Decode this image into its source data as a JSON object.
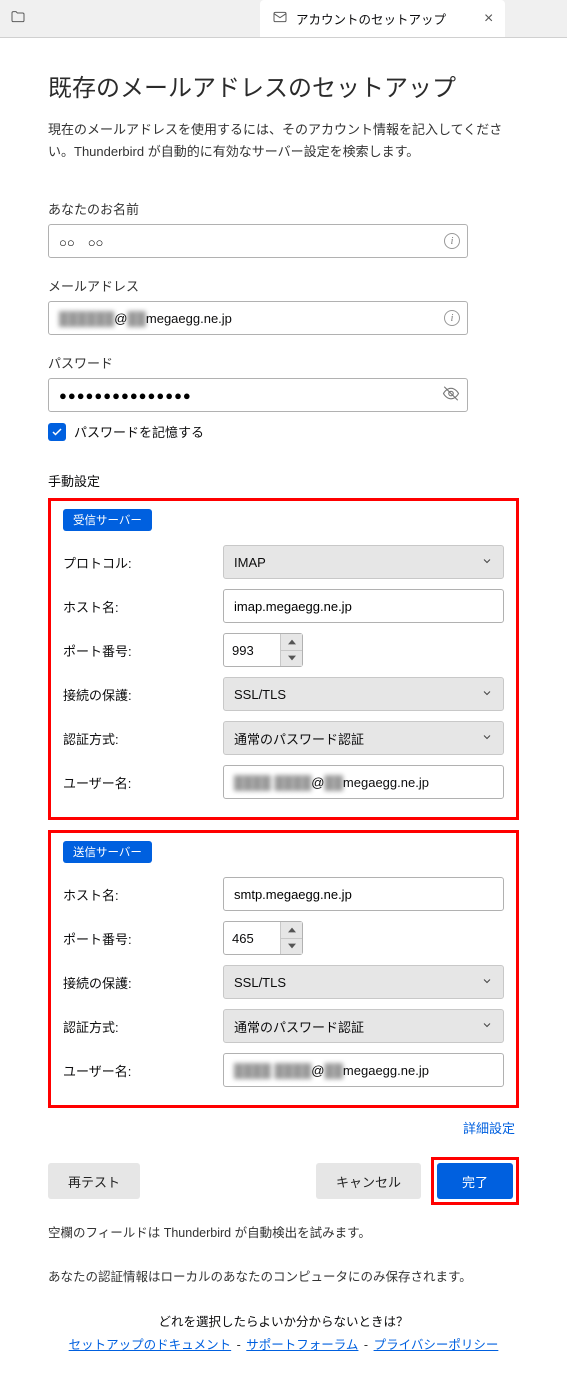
{
  "tab": {
    "title": "アカウントのセットアップ"
  },
  "heading": "既存のメールアドレスのセットアップ",
  "description": "現在のメールアドレスを使用するには、そのアカウント情報を記入してください。Thunderbird が自動的に有効なサーバー設定を検索します。",
  "fields": {
    "name_label": "あなたのお名前",
    "name_value": "○○　○○",
    "email_label": "メールアドレス",
    "email_hidden": "██████",
    "email_at": "@",
    "email_hidden2": "██",
    "email_domain": "megaegg.ne.jp",
    "password_label": "パスワード",
    "password_value": "●●●●●●●●●●●●●●●",
    "remember": "パスワードを記憶する"
  },
  "manual": {
    "title": "手動設定",
    "incoming": {
      "badge": "受信サーバー",
      "protocol_label": "プロトコル:",
      "protocol_value": "IMAP",
      "host_label": "ホスト名:",
      "host_value": "imap.megaegg.ne.jp",
      "port_label": "ポート番号:",
      "port_value": "993",
      "ssl_label": "接続の保護:",
      "ssl_value": "SSL/TLS",
      "auth_label": "認証方式:",
      "auth_value": "通常のパスワード認証",
      "user_label": "ユーザー名:",
      "user_hidden": "████ ████",
      "user_at": "@",
      "user_hidden2": "██",
      "user_domain": "megaegg.ne.jp"
    },
    "outgoing": {
      "badge": "送信サーバー",
      "host_label": "ホスト名:",
      "host_value": "smtp.megaegg.ne.jp",
      "port_label": "ポート番号:",
      "port_value": "465",
      "ssl_label": "接続の保護:",
      "ssl_value": "SSL/TLS",
      "auth_label": "認証方式:",
      "auth_value": "通常のパスワード認証",
      "user_label": "ユーザー名:",
      "user_hidden": "████ ████",
      "user_at": "@",
      "user_hidden2": "██",
      "user_domain": "megaegg.ne.jp"
    },
    "advanced": "詳細設定"
  },
  "buttons": {
    "retest": "再テスト",
    "cancel": "キャンセル",
    "done": "完了"
  },
  "notes": {
    "n1": "空欄のフィールドは Thunderbird が自動検出を試みます。",
    "n2": "あなたの認証情報はローカルのあなたのコンピュータにのみ保存されます。"
  },
  "footer": {
    "question": "どれを選択したらよいか分からないときは？",
    "link1": "セットアップのドキュメント",
    "link2": "サポートフォーラム",
    "link3": "プライバシーポリシー",
    "sep": "-"
  }
}
